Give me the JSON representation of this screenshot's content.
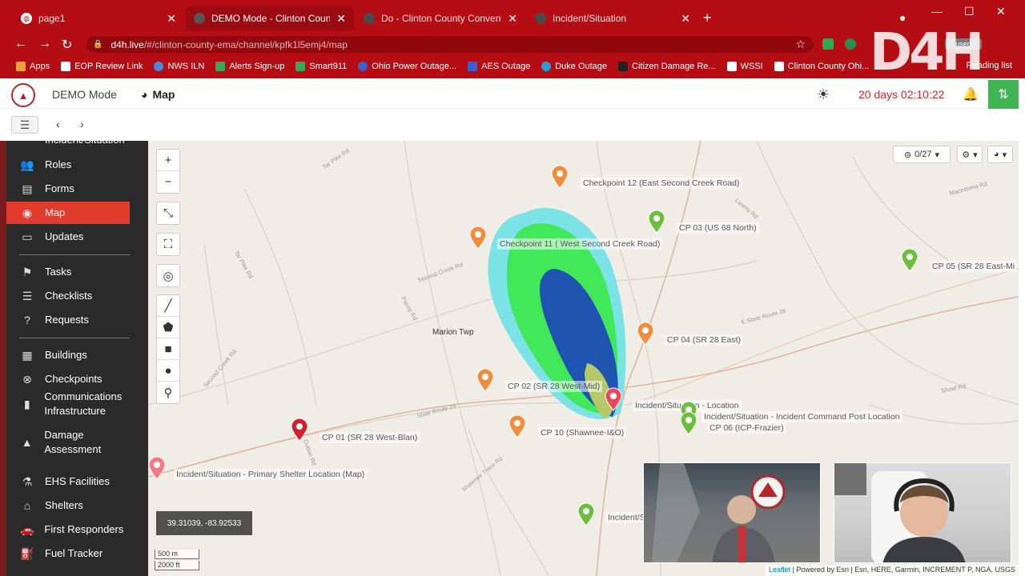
{
  "browser": {
    "tabs": [
      {
        "title": "page1",
        "active": false
      },
      {
        "title": "DEMO Mode - Clinton County E",
        "active": true
      },
      {
        "title": "Do - Clinton County Convention",
        "active": false
      },
      {
        "title": "Incident/Situation",
        "active": false
      }
    ],
    "url_host": "d4h.live",
    "url_path": "/#/clinton-county-ema/channel/kpfk1l5emj4/map",
    "bookmarks": [
      "Apps",
      "EOP Review Link",
      "NWS ILN",
      "Alerts Sign-up",
      "Smart911",
      "Ohio Power Outage...",
      "AES Outage",
      "Duke Outage",
      "Citizen Damage Re...",
      "WSSI",
      "Clinton County Ohi..."
    ],
    "reading_list": "Reading list",
    "ext_label": "used"
  },
  "watermark": "D4H",
  "header": {
    "mode": "DEMO Mode",
    "page_title": "Map",
    "countdown": "20 days 02:10:22"
  },
  "sidebar": {
    "partial_top": "Incident/Situation",
    "items": [
      {
        "label": "Roles",
        "icon": "roles-icon",
        "glyph": "👥"
      },
      {
        "label": "Forms",
        "icon": "forms-icon",
        "glyph": "▤"
      },
      {
        "label": "Map",
        "icon": "map-icon",
        "glyph": "◉",
        "active": true
      },
      {
        "label": "Updates",
        "icon": "updates-icon",
        "glyph": "▭"
      },
      {
        "label": "Tasks",
        "icon": "tasks-icon",
        "glyph": "⚑"
      },
      {
        "label": "Checklists",
        "icon": "checklists-icon",
        "glyph": "☰"
      },
      {
        "label": "Requests",
        "icon": "requests-icon",
        "glyph": "?"
      },
      {
        "label": "Buildings",
        "icon": "buildings-icon",
        "glyph": "▦"
      },
      {
        "label": "Checkpoints",
        "icon": "checkpoints-icon",
        "glyph": "⊗"
      },
      {
        "label": "Communications Infrastructure",
        "icon": "communications-icon",
        "glyph": "▮"
      },
      {
        "label": "Damage Assessment",
        "icon": "damage-icon",
        "glyph": "▲"
      },
      {
        "label": "EHS Facilities",
        "icon": "ehs-icon",
        "glyph": "⚗"
      },
      {
        "label": "Shelters",
        "icon": "shelters-icon",
        "glyph": "⌂"
      },
      {
        "label": "First Responders",
        "icon": "first-responders-icon",
        "glyph": "🚗"
      },
      {
        "label": "Fuel Tracker",
        "icon": "fuel-icon",
        "glyph": "⛽"
      }
    ]
  },
  "map": {
    "layers_count": "0/27",
    "coordinates": "39.31039, -83.92533",
    "scale_m": "500 m",
    "scale_ft": "2000 ft",
    "attribution_leaflet": "Leaflet",
    "attribution_rest": " | Powered by Esri | Esri, HERE, Garmin, INCREMENT P, NGA, USGS",
    "place": "Marion Twp",
    "roads": [
      "Tar Pike Rd",
      "Second Creek Rd",
      "Tar Pike Rd",
      "Second Creek Rd",
      "Pansy Rd",
      "State Route 28",
      "Dutton Rd",
      "Shawnee Trace Rd",
      "E State Route 28",
      "Larens Rd",
      "Macedonia Rd",
      "Shoaf Rd"
    ],
    "markers": [
      {
        "label": "Checkpoint 12 (East Second Creek Road)",
        "color": "#f08c3c"
      },
      {
        "label": "Checkpoint 11 ( West Second Creek Road)",
        "color": "#f08c3c"
      },
      {
        "label": "CP 03 (US 68 North)",
        "color": "#6bbf3c"
      },
      {
        "label": "CP 05 (SR 28 East-Mi",
        "color": "#6bbf3c"
      },
      {
        "label": "CP 04 (SR 28 East)",
        "color": "#f08c3c"
      },
      {
        "label": "CP 02 (SR 28 West-Mid)",
        "color": "#f08c3c"
      },
      {
        "label": "Incident/Situation - Location",
        "color": "#e8495a"
      },
      {
        "label": "Incident/Situation - Incident Command Post Location",
        "color": "#6bbf3c"
      },
      {
        "label": "CP 06 (ICP-Frazier)",
        "color": "#6bbf3c"
      },
      {
        "label": "CP 01 (SR 28 West-Blan)",
        "color": "#d0202a"
      },
      {
        "label": "CP 10 (Shawnee-I&O)",
        "color": "#f08c3c"
      },
      {
        "label": "Incident/Situation - Primary Shelter Location (Map)",
        "color": "#f07a86"
      },
      {
        "label": "Incident/S",
        "color": "#6bbf3c"
      }
    ]
  }
}
